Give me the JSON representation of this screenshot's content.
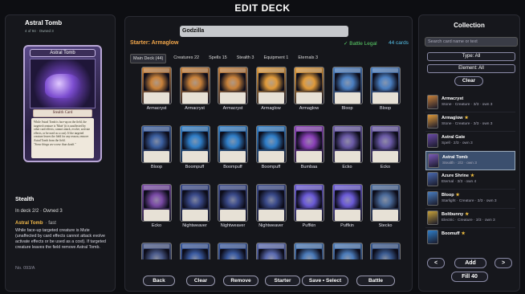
{
  "title": "EDIT DECK",
  "detail": {
    "name": "Astral Tomb",
    "sub": "4 of 94 · Owned 3",
    "card_title": "Astral Tomb",
    "card_type": "Stealth Card",
    "card_text": "While Astral Tomb is face-up on the field, the targeted creature is 'Mute' (it is unaffected by other card effects, cannot attack, evolve, activate effects, or be used as a cost). If the targeted creature leaves the field for any reason, remove Astral Tomb from the field.",
    "card_flavor": "\"Some things are worse than death.\"",
    "keyword": "Stealth",
    "in_deck": "In deck 2/2 · Owned 3",
    "ability_name": "Astral Tomb",
    "ability_speed": "· fast",
    "description": "While face-up targeted creature is Mute (unaffected by card effects cannot attack evolve activate effects or be used as a cost). If targeted creature leaves the field remove Astral Tomb.",
    "number": "No. 093/A"
  },
  "center": {
    "search_value": "Godzilla",
    "starter": "Starter: Armaglow",
    "legal": "✓ Battle Legal",
    "count": "44 cards",
    "tabs": [
      "Main Deck (44)",
      "Creatures 22",
      "Spells 15",
      "Stealth 3",
      "Equipment 1",
      "Eternals 3"
    ],
    "cards": [
      {
        "name": "Armacryst",
        "color": "#c8813a"
      },
      {
        "name": "Armacryst",
        "color": "#c8813a"
      },
      {
        "name": "Armacryst",
        "color": "#c8813a"
      },
      {
        "name": "Armaglow",
        "color": "#e09a3a"
      },
      {
        "name": "Armaglow",
        "color": "#e09a3a"
      },
      {
        "name": "Bloop",
        "color": "#4a7ec0"
      },
      {
        "name": "Bloop",
        "color": "#4a7ec0"
      },
      {
        "name": "Bloop",
        "color": "#3b5fa0"
      },
      {
        "name": "Boompuff",
        "color": "#2f7ec8"
      },
      {
        "name": "Boompuff",
        "color": "#2f7ec8"
      },
      {
        "name": "Boompuff",
        "color": "#2f7ec8"
      },
      {
        "name": "Bumbaa",
        "color": "#8a40b8"
      },
      {
        "name": "Ecko",
        "color": "#6a5aa6"
      },
      {
        "name": "Ecko",
        "color": "#6a5aa6"
      },
      {
        "name": "Ecko",
        "color": "#7a4aa6"
      },
      {
        "name": "Nightweaver",
        "color": "#3a4a8a"
      },
      {
        "name": "Nightweaver",
        "color": "#3a4a8a"
      },
      {
        "name": "Nightweaver",
        "color": "#3a4a8a"
      },
      {
        "name": "Puffkin",
        "color": "#6a5ad6"
      },
      {
        "name": "Puffkin",
        "color": "#6a5ad6"
      },
      {
        "name": "Stecko",
        "color": "#4a6a9a"
      },
      {
        "name": "",
        "color": "#4a5a8a"
      },
      {
        "name": "",
        "color": "#3a5aa0"
      },
      {
        "name": "",
        "color": "#3a5aa0"
      },
      {
        "name": "",
        "color": "#5a6ab0"
      },
      {
        "name": "",
        "color": "#4a7ab8"
      },
      {
        "name": "",
        "color": "#4a7ab8"
      },
      {
        "name": "",
        "color": "#3a5a90"
      }
    ],
    "buttons": [
      "Back",
      "Clear",
      "Remove",
      "Starter",
      "Save • Select",
      "Battle"
    ]
  },
  "collection": {
    "title": "Collection",
    "search_placeholder": "Search card name or text",
    "type_filter": "Type: All",
    "element_filter": "Element: All",
    "clear": "Clear",
    "items": [
      {
        "name": "Armacryst",
        "star": "",
        "desc": "Stone · Creature · 3/3 · own 3",
        "color": "#c8813a"
      },
      {
        "name": "Armaglow",
        "star": "★",
        "desc": "Stone · Creature · 3/3 · own 3",
        "color": "#e09a3a"
      },
      {
        "name": "Astral Gate",
        "star": "",
        "desc": "Spell · 2/3 · own 3",
        "color": "#6a4aa6"
      },
      {
        "name": "Astral Tomb",
        "star": "",
        "desc": "Stealth · 2/2 · own 3",
        "color": "#7a5ab8"
      },
      {
        "name": "Azure Shrine",
        "star": "★",
        "desc": "Eternal · 3/3 · own 4",
        "color": "#4a6ab0"
      },
      {
        "name": "Bloop",
        "star": "★",
        "desc": "Starlight · Creature · 3/3 · own 3",
        "color": "#4a7ec0"
      },
      {
        "name": "Boltbunny",
        "star": "★",
        "desc": "Electric · Creature · 3/3 · own 3",
        "color": "#c8a23a"
      },
      {
        "name": "Boomuff",
        "star": "★",
        "desc": "",
        "color": "#2f7ec8"
      }
    ],
    "add": "Add",
    "prev": "<",
    "next": ">",
    "fill": "Fill 40"
  }
}
